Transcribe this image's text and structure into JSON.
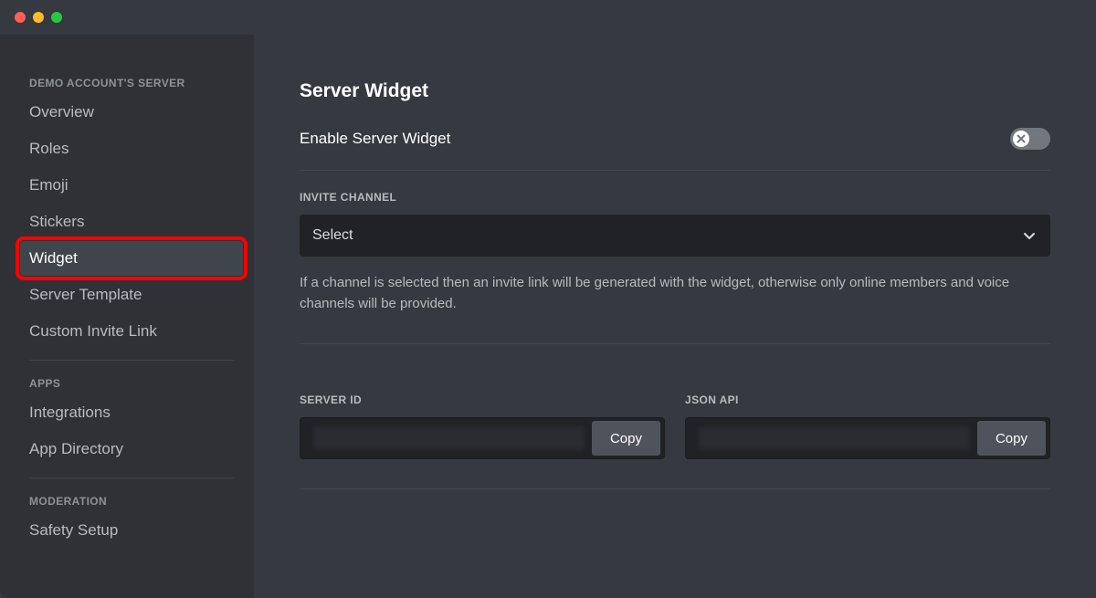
{
  "sidebar": {
    "groups": [
      {
        "header": "DEMO ACCOUNT'S SERVER",
        "items": [
          {
            "label": "Overview",
            "selected": false
          },
          {
            "label": "Roles",
            "selected": false
          },
          {
            "label": "Emoji",
            "selected": false
          },
          {
            "label": "Stickers",
            "selected": false
          },
          {
            "label": "Widget",
            "selected": true,
            "highlight": true
          },
          {
            "label": "Server Template",
            "selected": false
          },
          {
            "label": "Custom Invite Link",
            "selected": false
          }
        ]
      },
      {
        "header": "APPS",
        "items": [
          {
            "label": "Integrations",
            "selected": false
          },
          {
            "label": "App Directory",
            "selected": false
          }
        ]
      },
      {
        "header": "MODERATION",
        "items": [
          {
            "label": "Safety Setup",
            "selected": false
          }
        ]
      }
    ]
  },
  "main": {
    "title": "Server Widget",
    "enableLabel": "Enable Server Widget",
    "enableValue": false,
    "inviteChannel": {
      "label": "INVITE CHANNEL",
      "value": "Select",
      "help": "If a channel is selected then an invite link will be generated with the widget, otherwise only online members and voice channels will be provided."
    },
    "serverId": {
      "label": "SERVER ID",
      "copy": "Copy"
    },
    "jsonApi": {
      "label": "JSON API",
      "copy": "Copy"
    }
  }
}
